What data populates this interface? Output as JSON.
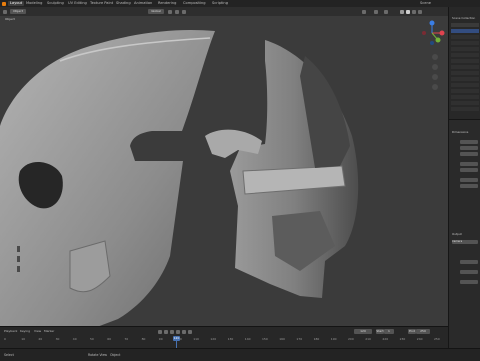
{
  "window": {
    "title": "Blender"
  },
  "workspace_tabs": [
    "Layout",
    "Modeling",
    "Sculpting",
    "UV Editing",
    "Texture Paint",
    "Shading",
    "Animation",
    "Rendering",
    "Compositing",
    "Scripting"
  ],
  "active_workspace": "Layout",
  "header_right": {
    "scene_label": "Scene"
  },
  "viewport": {
    "mode_label": "Object",
    "orientation": "Global",
    "object_label": "Object",
    "gizmo_axes": [
      "X",
      "Y",
      "Z"
    ]
  },
  "outliner": {
    "title": "Scene Collection"
  },
  "properties": {
    "section_dimensions": "Dimensions",
    "section_output": "Output",
    "field_camera": "Camera"
  },
  "timeline": {
    "menus": [
      "Playback",
      "Keying",
      "View",
      "Marker"
    ],
    "current_frame": "120",
    "start_label": "Start",
    "start_value": "1",
    "end_label": "End",
    "end_value": "250",
    "ticks": [
      "0",
      "10",
      "20",
      "30",
      "40",
      "50",
      "60",
      "70",
      "80",
      "90",
      "100",
      "110",
      "120",
      "130",
      "140",
      "150",
      "160",
      "170",
      "180",
      "190",
      "200",
      "210",
      "220",
      "230",
      "240",
      "250"
    ]
  },
  "statusbar": {
    "select": "Select",
    "rotate": "Rotate View",
    "context": "Object"
  },
  "colors": {
    "accent": "#3d7fd6",
    "active_frame": "#4772b3",
    "gizmo_x": "#e0434f",
    "gizmo_y": "#73b238",
    "gizmo_z": "#3a7ee5"
  }
}
